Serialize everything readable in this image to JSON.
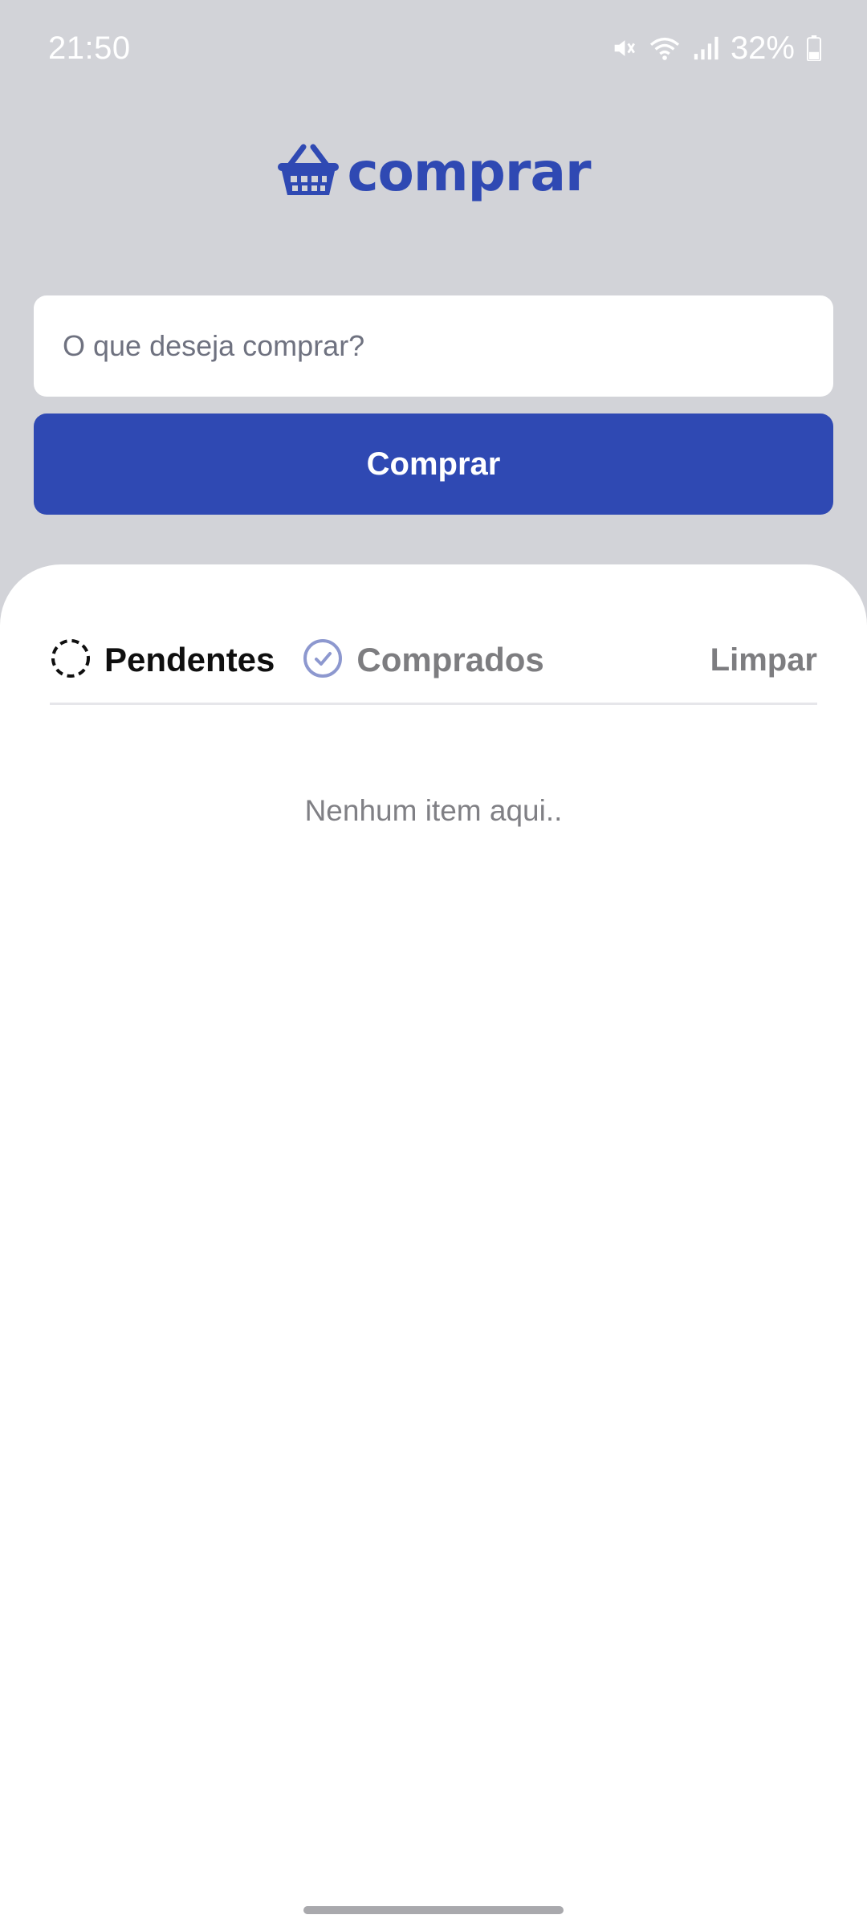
{
  "status_bar": {
    "time": "21:50",
    "battery": "32%",
    "icons": [
      "mute-icon",
      "wifi-icon",
      "signal-icon",
      "battery-icon"
    ]
  },
  "app": {
    "logo_text": "comprar",
    "brand_color": "#2f49b3"
  },
  "form": {
    "input_placeholder": "O que deseja comprar?",
    "input_value": "",
    "submit_label": "Comprar"
  },
  "filters": {
    "pending_label": "Pendentes",
    "bought_label": "Comprados",
    "clear_label": "Limpar",
    "selected": "Pendentes"
  },
  "list": {
    "items": [],
    "empty_message": "Nenhum item aqui.."
  }
}
